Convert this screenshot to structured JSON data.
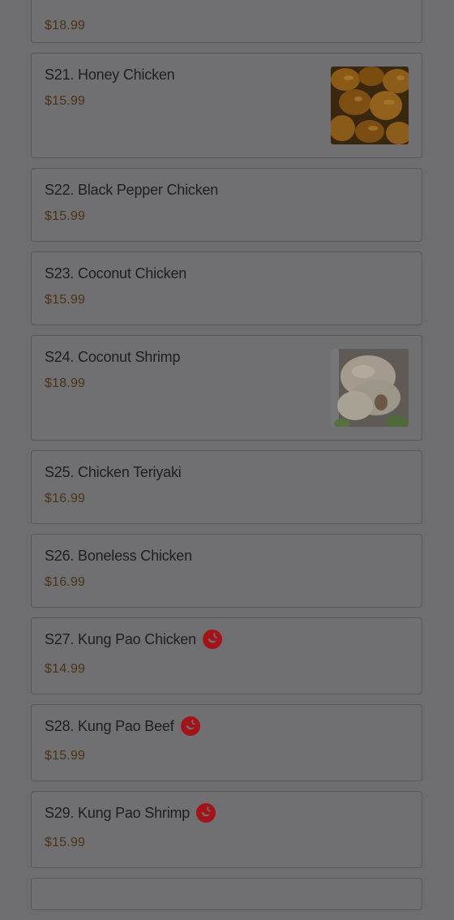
{
  "items": [
    {
      "id": "s20",
      "title": "",
      "price": "$18.99"
    },
    {
      "id": "s21",
      "title": "S21. Honey Chicken",
      "price": "$15.99",
      "image": "honey-chicken"
    },
    {
      "id": "s22",
      "title": "S22. Black Pepper Chicken",
      "price": "$15.99"
    },
    {
      "id": "s23",
      "title": "S23. Coconut Chicken",
      "price": "$15.99"
    },
    {
      "id": "s24",
      "title": "S24. Coconut Shrimp",
      "price": "$18.99",
      "image": "coconut-shrimp"
    },
    {
      "id": "s25",
      "title": "S25. Chicken Teriyaki",
      "price": "$16.99"
    },
    {
      "id": "s26",
      "title": "S26. Boneless Chicken",
      "price": "$16.99"
    },
    {
      "id": "s27",
      "title": "S27. Kung Pao Chicken",
      "price": "$14.99",
      "spicy": true,
      "icon": "spicy-icon"
    },
    {
      "id": "s28",
      "title": "S28. Kung Pao Beef",
      "price": "$15.99",
      "spicy": true,
      "icon": "spicy-icon"
    },
    {
      "id": "s29",
      "title": "S29. Kung Pao Shrimp",
      "price": "$15.99",
      "spicy": true,
      "icon": "spicy-icon"
    }
  ],
  "colors": {
    "overlay": "#6e6e70",
    "card_border": "#585858",
    "price": "#4a3316",
    "spicy": "#a3141a"
  }
}
